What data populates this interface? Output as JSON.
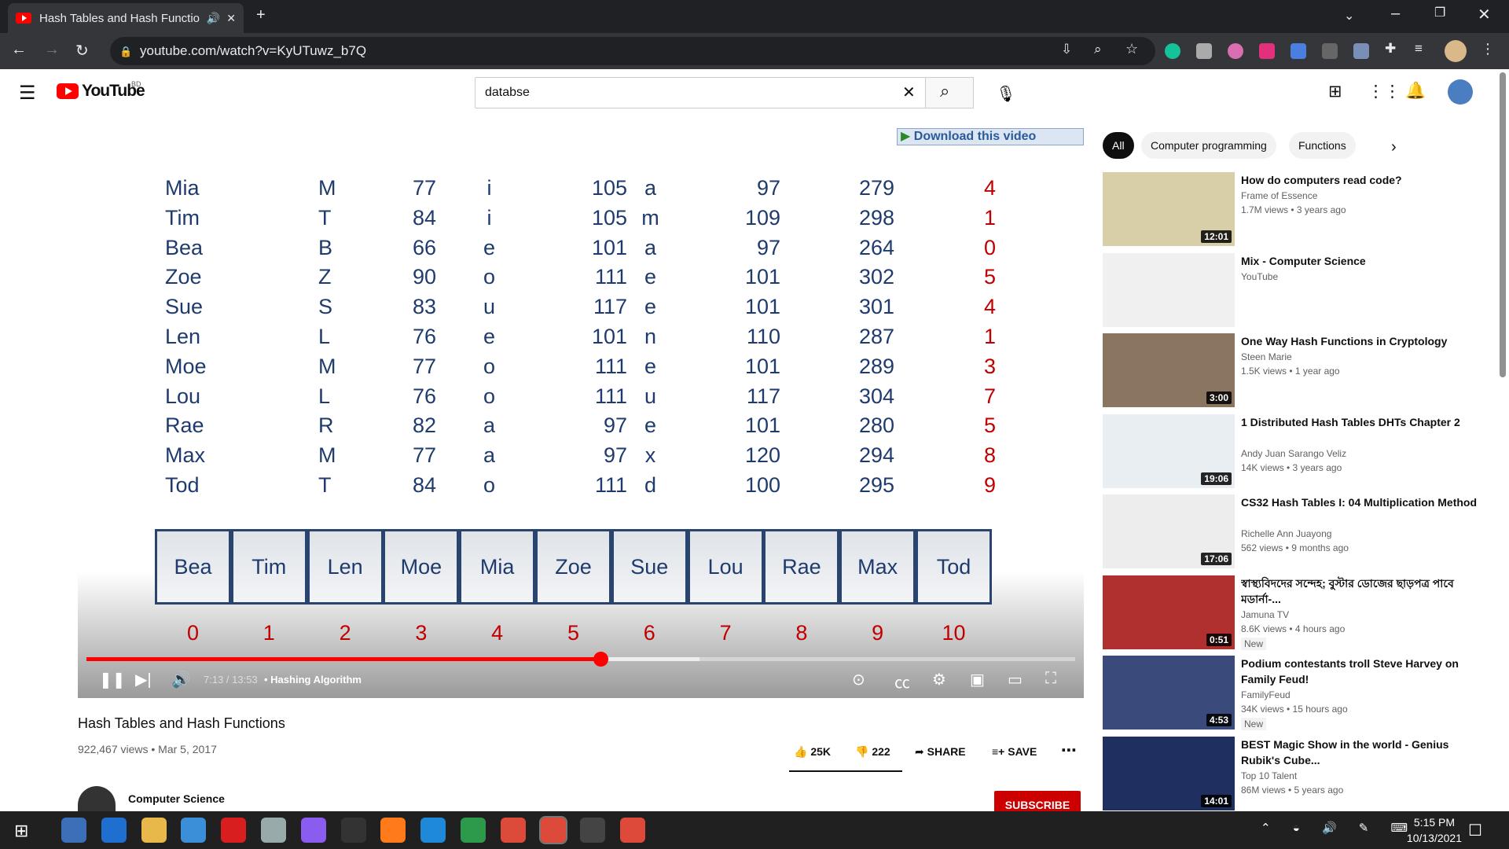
{
  "browser": {
    "tab_title": "Hash Tables and Hash Functions",
    "url": "youtube.com/watch?v=KyUTuwz_b7Q"
  },
  "youtube": {
    "logo": "YouTube",
    "region": "BD",
    "search_value": "databse"
  },
  "overlay": {
    "download": "Download this video"
  },
  "slide": {
    "rows": [
      [
        "Mia",
        "M",
        "77",
        "i",
        "105",
        "a",
        "97",
        "279",
        "4"
      ],
      [
        "Tim",
        "T",
        "84",
        "i",
        "105",
        "m",
        "109",
        "298",
        "1"
      ],
      [
        "Bea",
        "B",
        "66",
        "e",
        "101",
        "a",
        "97",
        "264",
        "0"
      ],
      [
        "Zoe",
        "Z",
        "90",
        "o",
        "111",
        "e",
        "101",
        "302",
        "5"
      ],
      [
        "Sue",
        "S",
        "83",
        "u",
        "117",
        "e",
        "101",
        "301",
        "4"
      ],
      [
        "Len",
        "L",
        "76",
        "e",
        "101",
        "n",
        "110",
        "287",
        "1"
      ],
      [
        "Moe",
        "M",
        "77",
        "o",
        "111",
        "e",
        "101",
        "289",
        "3"
      ],
      [
        "Lou",
        "L",
        "76",
        "o",
        "111",
        "u",
        "117",
        "304",
        "7"
      ],
      [
        "Rae",
        "R",
        "82",
        "a",
        "97",
        "e",
        "101",
        "280",
        "5"
      ],
      [
        "Max",
        "M",
        "77",
        "a",
        "97",
        "x",
        "120",
        "294",
        "8"
      ],
      [
        "Tod",
        "T",
        "84",
        "o",
        "111",
        "d",
        "100",
        "295",
        "9"
      ]
    ],
    "slots": [
      "Bea",
      "Tim",
      "Len",
      "Moe",
      "Mia",
      "Zoe",
      "Sue",
      "Lou",
      "Rae",
      "Max",
      "Tod"
    ],
    "indices": [
      "0",
      "1",
      "2",
      "3",
      "4",
      "5",
      "6",
      "7",
      "8",
      "9",
      "10"
    ]
  },
  "player": {
    "time": "7:13 / 13:53",
    "chapter": "• Hashing Algorithm",
    "progress": 0.52,
    "buffered": 0.62
  },
  "video": {
    "title": "Hash Tables and Hash Functions",
    "meta": "922,467 views • Mar 5, 2017",
    "likes": "25K",
    "dislikes": "222",
    "share": "SHARE",
    "save": "SAVE",
    "channel": "Computer Science",
    "subscribe": "SUBSCRIBE"
  },
  "chips": [
    "All",
    "Computer programming",
    "Functions"
  ],
  "recommendations": [
    {
      "title": "How do computers read code?",
      "channel": "Frame of Essence",
      "meta": "1.7M views • 3 years ago",
      "duration": "12:01",
      "thumb": "#d8cfa8"
    },
    {
      "title": "Mix - Computer Science",
      "channel": "YouTube",
      "meta": "",
      "duration": "",
      "thumb": "#f0f0f0"
    },
    {
      "title": "One Way Hash Functions in Cryptology",
      "channel": "Steen Marie",
      "meta": "1.5K views • 1 year ago",
      "duration": "3:00",
      "thumb": "#8a7560"
    },
    {
      "title": "1 Distributed Hash Tables DHTs Chapter 2",
      "channel": "Andy Juan Sarango Veliz",
      "meta": "14K views • 3 years ago",
      "duration": "19:06",
      "thumb": "#e9eef3"
    },
    {
      "title": "CS32 Hash Tables I: 04 Multiplication Method",
      "channel": "Richelle Ann Juayong",
      "meta": "562 views • 9 months ago",
      "duration": "17:06",
      "thumb": "#ededed"
    },
    {
      "title": "স্বাস্থ্যবিদদের সন্দেহ; বুস্টার ডোজের ছাড়পত্র পাবে মডার্না-...",
      "channel": "Jamuna TV",
      "meta": "8.6K views • 4 hours ago",
      "duration": "0:51",
      "thumb": "#b03030",
      "new": "New"
    },
    {
      "title": "Podium contestants troll Steve Harvey on Family Feud!",
      "channel": "FamilyFeud",
      "meta": "34K views • 15 hours ago",
      "duration": "4:53",
      "thumb": "#3a4a7a",
      "new": "New"
    },
    {
      "title": "BEST Magic Show in the world - Genius Rubik's Cube...",
      "channel": "Top 10 Talent",
      "meta": "86M views • 5 years ago",
      "duration": "14:01",
      "thumb": "#1f3060"
    }
  ],
  "taskbar": {
    "time": "5:15 PM",
    "date": "10/13/2021"
  }
}
